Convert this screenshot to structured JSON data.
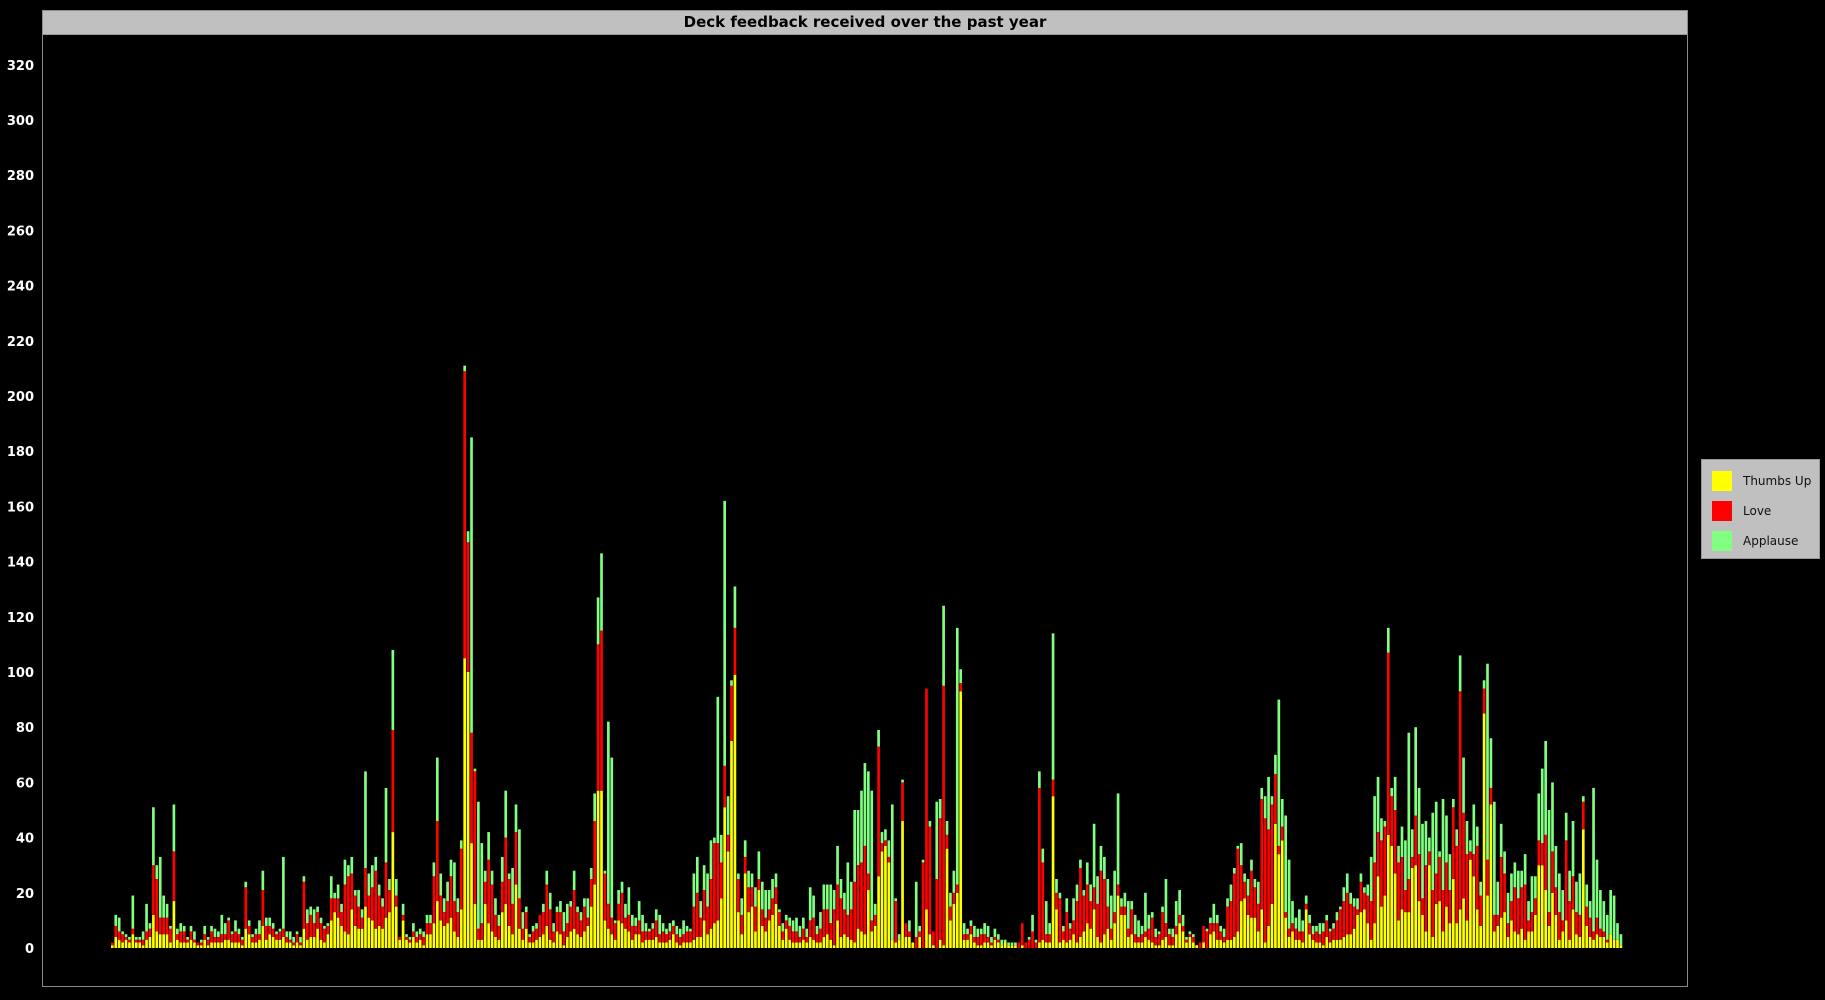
{
  "chart_data": {
    "type": "bar",
    "stacked": true,
    "title": "Deck feedback received over the past year",
    "xlabel": "",
    "ylabel": "",
    "ylim": [
      0,
      330
    ],
    "yticks": [
      0,
      20,
      40,
      60,
      80,
      100,
      120,
      140,
      160,
      180,
      200,
      220,
      240,
      260,
      280,
      300,
      320
    ],
    "grid": false,
    "legend_position": "right",
    "background": "#000000",
    "series": [
      {
        "name": "Thumbs Up",
        "color": "#ffff00",
        "values": [
          1,
          4,
          3,
          2,
          3,
          2,
          5,
          2,
          2,
          1,
          3,
          4,
          12,
          6,
          5,
          5,
          5,
          2,
          17,
          3,
          2,
          2,
          2,
          3,
          2,
          1,
          1,
          3,
          1,
          2,
          2,
          2,
          2,
          3,
          3,
          2,
          2,
          2,
          1,
          7,
          5,
          2,
          2,
          3,
          8,
          3,
          5,
          4,
          3,
          3,
          4,
          2,
          2,
          1,
          2,
          1,
          7,
          3,
          4,
          4,
          7,
          3,
          2,
          5,
          10,
          13,
          11,
          8,
          6,
          5,
          14,
          8,
          7,
          7,
          15,
          11,
          10,
          7,
          8,
          7,
          11,
          13,
          42,
          15,
          3,
          10,
          3,
          2,
          4,
          2,
          3,
          1,
          5,
          5,
          9,
          17,
          10,
          8,
          9,
          11,
          6,
          4,
          14,
          105,
          100,
          38,
          16,
          3,
          3,
          16,
          9,
          6,
          4,
          3,
          13,
          16,
          8,
          5,
          23,
          7,
          3,
          7,
          2,
          2,
          3,
          4,
          5,
          8,
          3,
          2,
          6,
          5,
          1,
          4,
          6,
          7,
          5,
          4,
          6,
          8,
          15,
          23,
          57,
          57,
          10,
          7,
          5,
          3,
          10,
          9,
          7,
          6,
          3,
          5,
          5,
          2,
          3,
          3,
          3,
          4,
          2,
          2,
          2,
          3,
          5,
          2,
          1,
          2,
          2,
          2,
          3,
          4,
          4,
          10,
          5,
          7,
          9,
          10,
          18,
          51,
          35,
          75,
          99,
          13,
          5,
          27,
          13,
          15,
          6,
          21,
          8,
          6,
          10,
          12,
          16,
          8,
          3,
          7,
          3,
          2,
          2,
          2,
          3,
          2,
          4,
          3,
          2,
          2,
          4,
          5,
          3,
          1,
          10,
          4,
          5,
          4,
          3,
          2,
          7,
          6,
          5,
          21,
          6,
          8,
          26,
          35,
          37,
          31,
          3,
          2,
          3,
          46,
          4,
          4,
          2,
          0,
          4,
          0,
          14,
          5,
          1,
          0,
          3,
          1,
          36,
          10,
          16,
          20,
          93,
          3,
          3,
          5,
          2,
          1,
          1,
          2,
          2,
          1,
          3,
          2,
          1,
          2,
          1,
          1,
          1,
          0,
          1,
          0,
          0,
          0,
          0,
          2,
          3,
          2,
          2,
          55,
          14,
          2,
          3,
          2,
          3,
          5,
          2,
          4,
          6,
          9,
          7,
          14,
          4,
          2,
          5,
          7,
          3,
          9,
          19,
          12,
          12,
          4,
          5,
          2,
          2,
          2,
          4,
          3,
          2,
          1,
          1,
          3,
          4,
          1,
          1,
          5,
          9,
          6,
          2,
          4,
          2,
          1,
          0,
          2,
          0,
          5,
          6,
          3,
          3,
          2,
          3,
          3,
          4,
          6,
          17,
          18,
          12,
          11,
          11,
          6,
          14,
          2,
          8,
          16,
          45,
          34,
          39,
          11,
          4,
          6,
          3,
          3,
          2,
          14,
          5,
          3,
          2,
          2,
          1,
          4,
          2,
          3,
          3,
          3,
          4,
          5,
          5,
          7,
          12,
          13,
          14,
          9,
          3,
          9,
          26,
          15,
          19,
          41,
          37,
          27,
          10,
          14,
          13,
          13,
          29,
          30,
          17,
          12,
          6,
          30,
          4,
          16,
          17,
          6,
          15,
          9,
          25,
          9,
          14,
          18,
          10,
          32,
          26,
          14,
          8,
          85,
          19,
          52,
          6,
          8,
          11,
          13,
          4,
          10,
          6,
          5,
          7,
          3,
          6,
          6,
          12,
          30,
          30,
          21,
          8,
          20,
          12,
          3,
          6,
          10,
          3,
          14,
          5,
          4,
          43,
          8,
          4,
          3,
          5,
          4,
          4,
          2,
          5,
          3,
          3,
          1
        ]
      },
      {
        "name": "Love",
        "color": "#ff0000",
        "values": [
          1,
          4,
          3,
          3,
          1,
          1,
          2,
          1,
          1,
          2,
          3,
          3,
          18,
          19,
          6,
          6,
          6,
          5,
          18,
          2,
          4,
          4,
          1,
          3,
          1,
          1,
          1,
          2,
          2,
          4,
          2,
          2,
          3,
          2,
          7,
          3,
          4,
          3,
          2,
          15,
          3,
          2,
          3,
          2,
          13,
          5,
          3,
          3,
          2,
          3,
          3,
          2,
          1,
          1,
          3,
          1,
          17,
          6,
          8,
          5,
          6,
          6,
          5,
          3,
          8,
          5,
          7,
          5,
          17,
          21,
          13,
          11,
          8,
          4,
          14,
          8,
          12,
          21,
          11,
          8,
          20,
          8,
          37,
          4,
          1,
          2,
          1,
          1,
          2,
          2,
          2,
          3,
          4,
          4,
          17,
          29,
          9,
          5,
          8,
          15,
          11,
          9,
          22,
          104,
          47,
          40,
          48,
          4,
          6,
          8,
          23,
          17,
          8,
          5,
          11,
          24,
          17,
          11,
          19,
          11,
          4,
          6,
          2,
          4,
          4,
          8,
          8,
          15,
          11,
          4,
          7,
          8,
          5,
          5,
          9,
          14,
          8,
          6,
          9,
          3,
          10,
          23,
          53,
          58,
          17,
          9,
          6,
          6,
          6,
          11,
          4,
          6,
          5,
          3,
          5,
          4,
          3,
          3,
          4,
          6,
          3,
          4,
          3,
          3,
          3,
          3,
          3,
          3,
          4,
          4,
          12,
          16,
          7,
          11,
          10,
          18,
          29,
          28,
          13,
          15,
          6,
          20,
          17,
          12,
          7,
          6,
          9,
          7,
          9,
          4,
          6,
          5,
          4,
          6,
          6,
          5,
          3,
          3,
          5,
          4,
          4,
          2,
          4,
          2,
          6,
          8,
          3,
          5,
          10,
          9,
          6,
          13,
          13,
          14,
          9,
          8,
          11,
          22,
          23,
          25,
          32,
          6,
          4,
          4,
          47,
          3,
          2,
          2,
          0,
          15,
          0,
          14,
          5,
          2,
          0,
          4,
          2,
          31,
          80,
          39,
          5,
          25,
          44,
          94,
          5,
          5,
          4,
          3,
          3,
          2,
          2,
          3,
          2,
          3,
          4,
          3,
          2,
          1,
          1,
          1,
          0,
          0,
          0,
          0,
          0,
          2,
          8,
          2,
          3,
          6,
          2,
          56,
          28,
          3,
          3,
          6,
          6,
          16,
          3,
          11,
          4,
          5,
          15,
          25,
          13,
          14,
          10,
          8,
          12,
          26,
          20,
          8,
          4,
          4,
          4,
          3,
          3,
          3,
          9,
          3,
          2,
          3,
          2,
          4,
          9,
          3,
          4,
          10,
          5,
          4,
          3,
          3,
          3,
          2,
          1,
          1,
          2,
          0,
          2,
          6,
          6,
          4,
          3,
          6,
          3,
          2,
          12,
          14,
          23,
          30,
          13,
          6,
          7,
          17,
          11,
          10,
          40,
          45,
          35,
          36,
          18,
          3,
          5,
          2,
          3,
          3,
          4,
          3,
          4,
          2,
          4,
          2,
          4,
          3,
          5,
          6,
          4,
          4,
          7,
          11,
          13,
          15,
          11,
          8,
          2,
          11,
          6,
          10,
          14,
          22,
          16,
          24,
          25,
          66,
          18,
          23,
          21,
          19,
          8,
          12,
          4,
          18,
          17,
          6,
          24,
          5,
          17,
          11,
          16,
          15,
          16,
          12,
          26,
          28,
          79,
          31,
          24,
          3,
          8,
          23,
          11,
          9,
          13,
          6,
          6,
          4,
          22,
          14,
          5,
          7,
          16,
          13,
          15,
          20,
          4,
          7,
          6,
          9,
          8,
          20,
          5,
          15,
          10,
          10,
          4,
          29,
          14,
          12,
          8,
          8,
          10,
          7,
          7,
          3,
          6,
          3,
          2,
          1
        ]
      },
      {
        "name": "Applause",
        "color": "#80ff80",
        "values": [
          0,
          4,
          5,
          1,
          1,
          1,
          12,
          1,
          1,
          3,
          10,
          2,
          21,
          5,
          22,
          8,
          5,
          1,
          17,
          2,
          3,
          2,
          1,
          2,
          3,
          0,
          1,
          3,
          1,
          2,
          3,
          2,
          7,
          4,
          1,
          1,
          4,
          2,
          1,
          2,
          2,
          1,
          2,
          5,
          7,
          3,
          3,
          2,
          1,
          1,
          26,
          2,
          3,
          2,
          1,
          2,
          2,
          5,
          3,
          5,
          2,
          2,
          1,
          1,
          8,
          2,
          5,
          3,
          9,
          4,
          6,
          2,
          6,
          3,
          35,
          8,
          8,
          5,
          4,
          3,
          27,
          4,
          29,
          6,
          0,
          4,
          1,
          1,
          3,
          2,
          2,
          2,
          3,
          3,
          5,
          23,
          8,
          5,
          7,
          6,
          14,
          5,
          3,
          2,
          4,
          107,
          1,
          46,
          29,
          4,
          10,
          5,
          6,
          4,
          9,
          17,
          2,
          13,
          10,
          25,
          6,
          2,
          1,
          2,
          2,
          0,
          3,
          5,
          6,
          3,
          2,
          4,
          7,
          7,
          2,
          7,
          2,
          3,
          3,
          7,
          4,
          10,
          17,
          28,
          1,
          66,
          58,
          1,
          5,
          4,
          5,
          10,
          4,
          3,
          7,
          6,
          3,
          1,
          2,
          4,
          7,
          3,
          2,
          3,
          2,
          3,
          3,
          5,
          2,
          1,
          12,
          13,
          6,
          9,
          12,
          14,
          2,
          53,
          10,
          96,
          14,
          2,
          15,
          2,
          6,
          6,
          6,
          5,
          7,
          10,
          10,
          10,
          7,
          7,
          5,
          1,
          3,
          2,
          3,
          4,
          5,
          4,
          4,
          3,
          12,
          8,
          3,
          6,
          9,
          9,
          14,
          7,
          14,
          7,
          6,
          19,
          10,
          26,
          20,
          26,
          30,
          37,
          47,
          4,
          6,
          4,
          4,
          6,
          49,
          1,
          2,
          1,
          0,
          4,
          0,
          20,
          2,
          1,
          0,
          2,
          0,
          28,
          7,
          29,
          5,
          5,
          8,
          93,
          5,
          4,
          2,
          2,
          4,
          3,
          2,
          4,
          4,
          2,
          3,
          2,
          2,
          1,
          1,
          1,
          1,
          0,
          0,
          0,
          1,
          6,
          1,
          6,
          5,
          12,
          4,
          53,
          5,
          2,
          2,
          5,
          2,
          8,
          6,
          3,
          2,
          8,
          6,
          23,
          10,
          9,
          8,
          10,
          12,
          15,
          33,
          3,
          5,
          10,
          3,
          7,
          6,
          3,
          14,
          5,
          2,
          3,
          1,
          2,
          16,
          2,
          3,
          9,
          9,
          4,
          1,
          1,
          1,
          0,
          0,
          0,
          1,
          2,
          7,
          3,
          2,
          3,
          3,
          6,
          2,
          1,
          8,
          3,
          6,
          4,
          3,
          8,
          4,
          8,
          19,
          3,
          7,
          53,
          10,
          35,
          25,
          8,
          4,
          8,
          4,
          3,
          3,
          3,
          2,
          4,
          3,
          2,
          1,
          2,
          3,
          1,
          5,
          7,
          4,
          3,
          4,
          3,
          2,
          4,
          16,
          24,
          20,
          8,
          2,
          9,
          3,
          12,
          6,
          11,
          18,
          53,
          10,
          32,
          24,
          27,
          16,
          5,
          28,
          26,
          2,
          33,
          17,
          13,
          3,
          6,
          13,
          20,
          12,
          4,
          18,
          7,
          5,
          3,
          71,
          18,
          41,
          12,
          12,
          8,
          11,
          10,
          9,
          10,
          6,
          11,
          7,
          13,
          8,
          17,
          27,
          34,
          37,
          25,
          15,
          14,
          11,
          10,
          11,
          20,
          11,
          15,
          2,
          8,
          6,
          52,
          21,
          14,
          11,
          9,
          16,
          16,
          6,
          4,
          4,
          3,
          1
        ]
      }
    ]
  }
}
